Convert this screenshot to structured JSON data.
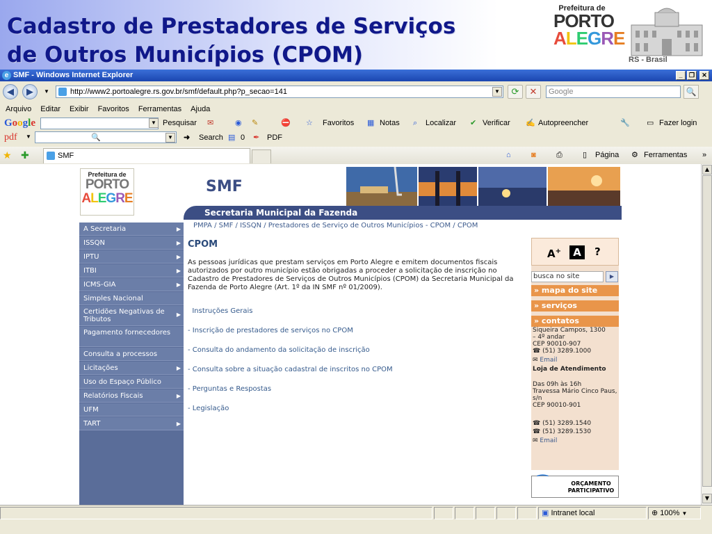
{
  "slide": {
    "title_line1": "Cadastro de Prestadores de Serviços",
    "title_line2": "de Outros Municípios (CPOM)",
    "logo_top": "Prefeitura de",
    "logo_porto": "PORTO",
    "logo_alegre": "ALEGRE",
    "rs_brasil": "RS - Brasil"
  },
  "window": {
    "title": "SMF - Windows Internet Explorer",
    "url": "http://www2.portoalegre.rs.gov.br/smf/default.php?p_secao=141",
    "search_placeholder": "Google",
    "menu": [
      "Arquivo",
      "Editar",
      "Exibir",
      "Favoritos",
      "Ferramentas",
      "Ajuda"
    ],
    "google_bar": {
      "logo": "Google",
      "search_label": "Pesquisar",
      "favorites": "Favoritos",
      "notes": "Notas",
      "find": "Localizar",
      "check": "Verificar",
      "autofill": "Autopreencher",
      "login": "Fazer login"
    },
    "pdf_bar": {
      "logo": "pdf",
      "search": "Search",
      "count": "0",
      "pdf": "PDF"
    },
    "tab_label": "SMF",
    "cmd_page": "Página",
    "cmd_tools": "Ferramentas",
    "status_zone": "Intranet local",
    "zoom": "100%"
  },
  "site": {
    "logo_top": "Prefeitura de",
    "logo_porto": "PORTO",
    "logo_alegre": "ALEGRE",
    "smf": "SMF",
    "header_band": "Secretaria Municipal da Fazenda",
    "breadcrumb": "PMPA / SMF / ISSQN / Prestadores de Serviço de Outros Municípios - CPOM / CPOM",
    "nav": [
      {
        "label": "A Secretaria",
        "arrow": true
      },
      {
        "label": "ISSQN",
        "arrow": true
      },
      {
        "label": "IPTU",
        "arrow": true
      },
      {
        "label": "ITBI",
        "arrow": true
      },
      {
        "label": "ICMS-GIA",
        "arrow": true
      },
      {
        "label": "Simples Nacional",
        "arrow": false
      },
      {
        "label": "Certidões Negativas de Tributos",
        "arrow": true,
        "two": true
      },
      {
        "label": "Pagamento fornecedores",
        "arrow": false,
        "two": true
      },
      {
        "label": "Consulta a processos",
        "arrow": false
      },
      {
        "label": "Licitações",
        "arrow": true
      },
      {
        "label": "Uso do Espaço Público",
        "arrow": false
      },
      {
        "label": "Relatórios Fiscais",
        "arrow": true
      },
      {
        "label": "UFM",
        "arrow": false
      },
      {
        "label": "TART",
        "arrow": true
      }
    ],
    "content": {
      "heading": "CPOM",
      "intro": "As pessoas jurídicas que prestam serviços em Porto Alegre e emitem documentos fiscais autorizados por outro município estão obrigadas a proceder a solicitação de inscrição no Cadastro de Prestadores de Serviços de Outros Municípios (CPOM) da Secretaria Municipal da Fazenda de Porto Alegre (Art. 1º da IN SMF nº 01/2009).",
      "links": [
        "  Instruções Gerais",
        "- Inscrição de prestadores de serviços no CPOM",
        "- Consulta do andamento da solicitação de inscrição",
        "- Consulta sobre a situação cadastral de inscritos no CPOM",
        "- Perguntas e Respostas",
        "- Legislação"
      ]
    },
    "right": {
      "font_bigger": "A",
      "font_normal": "A",
      "help": "?",
      "search_value": "busca no site",
      "map": "» mapa do site",
      "services": "» serviços",
      "contacts": "» contatos",
      "addr1": "Siqueira Campos, 1300",
      "addr2": "– 4º andar",
      "cep1": "CEP 90010-907",
      "phone1": "(51) 3289.1000",
      "email": "Email",
      "store": "Loja de Atendimento",
      "hours": "Das 09h às 16h",
      "addr3": "Travessa Mário Cinco Paus, s/n",
      "cep2": "CEP 90010-901",
      "phone2": "(51) 3289.1540",
      "phone3": "(51) 3289.1530",
      "email2": "Email",
      "orc1": "ORÇAMENTO",
      "orc2": "PARTICIPATIVO"
    }
  },
  "colors": {
    "title": "#10188a",
    "site_blue": "#3c4e84",
    "orange": "#e9954a",
    "nav": "#6b7ea8"
  }
}
